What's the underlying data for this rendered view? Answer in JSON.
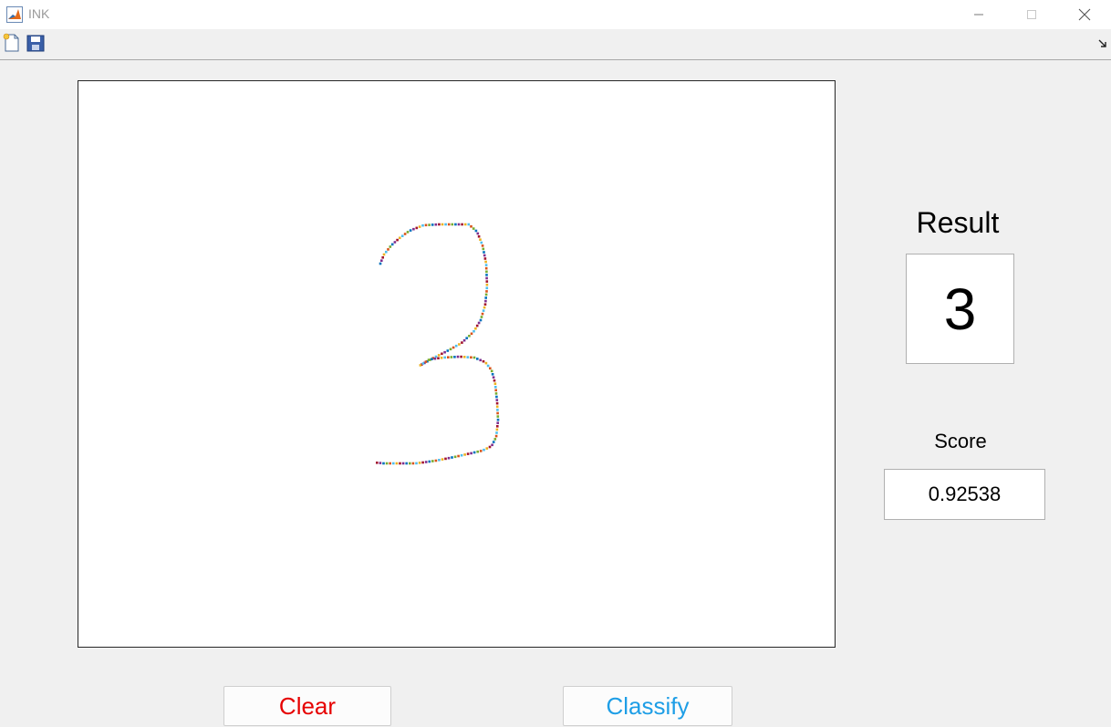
{
  "window": {
    "title": "INK"
  },
  "toolbar": {
    "icons": [
      "new-figure-icon",
      "save-icon",
      "undock-icon"
    ]
  },
  "canvas": {
    "stroke_label": "3",
    "marker_colors": [
      "#0072bd",
      "#d95319",
      "#edb120",
      "#7e2f8e",
      "#77ac30",
      "#4dbeee",
      "#a2142f"
    ]
  },
  "result": {
    "label": "Result",
    "value": "3"
  },
  "score": {
    "label": "Score",
    "value": "0.92538"
  },
  "buttons": {
    "clear": {
      "label": "Clear",
      "color": "#e60000"
    },
    "classify": {
      "label": "Classify",
      "color": "#1e9ee6"
    }
  }
}
